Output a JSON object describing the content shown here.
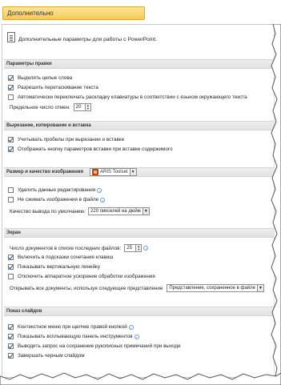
{
  "tab": {
    "title": "Дополнительно"
  },
  "header": {
    "description": "Дополнительные параметры для работы с PowerPoint."
  },
  "sections": {
    "editing": {
      "title": "Параметры правки",
      "items": [
        {
          "label": "Выделять целые слова",
          "checked": true
        },
        {
          "label": "Разрешить перетаскивание текста",
          "checked": true
        },
        {
          "label": "Автоматически переключать раскладку клавиатуры в соответствии с языком окружающего текста",
          "checked": false
        }
      ],
      "undo_label": "Предельное число отмен:",
      "undo_value": "20"
    },
    "clipboard": {
      "title": "Вырезание, копирование и вставка",
      "items": [
        {
          "label": "Учитывать пробелы при вырезании и вставке",
          "checked": true
        },
        {
          "label": "Отображать кнопку параметров вставки при вставке содержимого",
          "checked": true
        }
      ]
    },
    "image": {
      "title": "Размер и качество изображения",
      "file_value": "ARIS Toolset",
      "items": [
        {
          "label": "Удалить данные редактирования",
          "checked": false
        },
        {
          "label": "Не сжимать изображения в файле",
          "checked": false
        }
      ],
      "quality_label": "Качество вывода по умолчанию:",
      "quality_value": "220 пикселей на дюйм"
    },
    "display": {
      "title": "Экран",
      "recent_label": "Число документов в списке последних файлов:",
      "recent_value": "25",
      "items": [
        {
          "label": "Включить в подсказки сочетания клавиш",
          "checked": true
        },
        {
          "label": "Показывать вертикальную линейку",
          "checked": true
        },
        {
          "label": "Отключить аппаратное ускорение обработки изображения",
          "checked": false
        }
      ],
      "open_label": "Открывать все документы, используя следующее представление",
      "open_value": "Представление, сохраненное в файле"
    },
    "slideshow": {
      "title": "Показ слайдов",
      "items": [
        {
          "label": "Контекстное меню при щелчке правой кнопкой",
          "checked": true
        },
        {
          "label": "Показывать всплывающую панель инструментов",
          "checked": true
        },
        {
          "label": "Выводить запрос на сохранение рукописных примечаний при выходе",
          "checked": true
        },
        {
          "label": "Завершать черным слайдом",
          "checked": true
        }
      ]
    }
  }
}
